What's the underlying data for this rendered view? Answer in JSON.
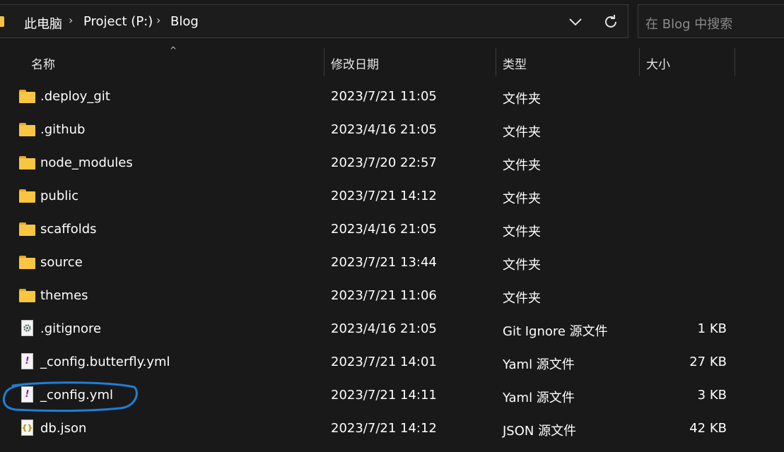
{
  "breadcrumb": {
    "items": [
      "此电脑",
      "Project (P:)",
      "Blog"
    ],
    "separator": "›"
  },
  "search": {
    "placeholder": "在 Blog 中搜索"
  },
  "columns": {
    "name": "名称",
    "modified": "修改日期",
    "type": "类型",
    "size": "大小"
  },
  "files": [
    {
      "name": ".deploy_git",
      "modified": "2023/7/21 11:05",
      "type": "文件夹",
      "size": "",
      "icon": "folder-icon"
    },
    {
      "name": ".github",
      "modified": "2023/4/16 21:05",
      "type": "文件夹",
      "size": "",
      "icon": "folder-icon"
    },
    {
      "name": "node_modules",
      "modified": "2023/7/20 22:57",
      "type": "文件夹",
      "size": "",
      "icon": "folder-icon"
    },
    {
      "name": "public",
      "modified": "2023/7/21 14:12",
      "type": "文件夹",
      "size": "",
      "icon": "folder-icon"
    },
    {
      "name": "scaffolds",
      "modified": "2023/4/16 21:05",
      "type": "文件夹",
      "size": "",
      "icon": "folder-icon"
    },
    {
      "name": "source",
      "modified": "2023/7/21 13:44",
      "type": "文件夹",
      "size": "",
      "icon": "folder-icon"
    },
    {
      "name": "themes",
      "modified": "2023/7/21 11:06",
      "type": "文件夹",
      "size": "",
      "icon": "folder-icon"
    },
    {
      "name": ".gitignore",
      "modified": "2023/4/16 21:05",
      "type": "Git Ignore 源文件",
      "size": "1 KB",
      "icon": "gitignore-file-icon"
    },
    {
      "name": "_config.butterfly.yml",
      "modified": "2023/7/21 14:01",
      "type": "Yaml 源文件",
      "size": "27 KB",
      "icon": "yaml-file-icon"
    },
    {
      "name": "_config.yml",
      "modified": "2023/7/21 14:11",
      "type": "Yaml 源文件",
      "size": "3 KB",
      "icon": "yaml-file-icon"
    },
    {
      "name": "db.json",
      "modified": "2023/7/21 14:12",
      "type": "JSON 源文件",
      "size": "42 KB",
      "icon": "json-file-icon"
    }
  ],
  "colors": {
    "background": "#191919",
    "folder": "#f8c640",
    "annotation_circle": "#1e7fd6"
  }
}
